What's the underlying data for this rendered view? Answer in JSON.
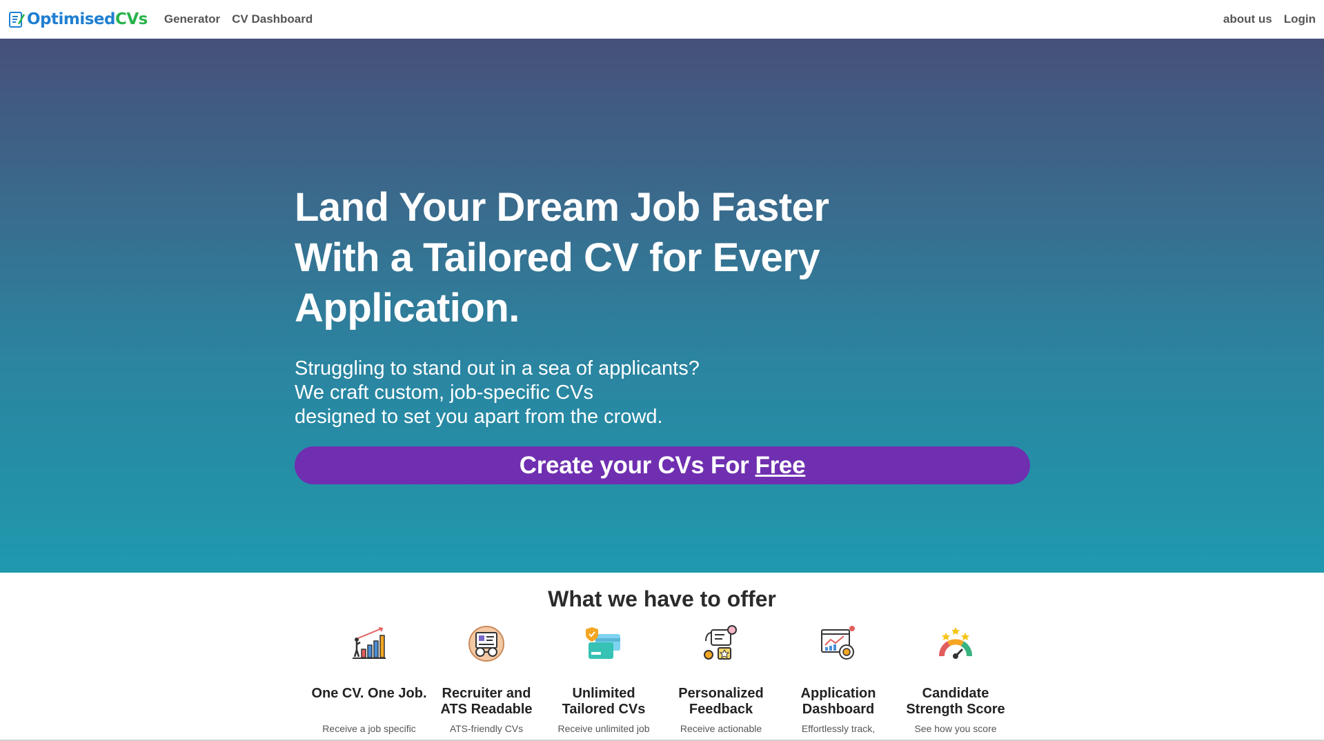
{
  "nav": {
    "brand_part1": "Optimised",
    "brand_part2": "CVs",
    "links": [
      "Generator",
      "CV Dashboard"
    ],
    "right_links": [
      "about us",
      "Login"
    ]
  },
  "hero": {
    "title_line1": "Land Your Dream Job Faster",
    "title_line2": "With a Tailored CV for Every Application.",
    "sub_line1": "Struggling to stand out in a sea of applicants?",
    "sub_line2": "We craft custom, job-specific CVs",
    "sub_line3": "designed to set you apart from the crowd.",
    "cta_text": "Create your CVs For",
    "cta_free": "Free"
  },
  "offer": {
    "title": "What we have to offer",
    "features": [
      {
        "icon": "growth-chart-icon",
        "title": "One CV. One Job.",
        "desc": "Receive a job specific"
      },
      {
        "icon": "robot-reader-icon",
        "title": "Recruiter and ATS Readable",
        "desc": "ATS-friendly CVs"
      },
      {
        "icon": "cards-icon",
        "title": "Unlimited Tailored CVs",
        "desc": "Receive unlimited job"
      },
      {
        "icon": "feedback-icon",
        "title": "Personalized Feedback",
        "desc": "Receive actionable"
      },
      {
        "icon": "dashboard-icon",
        "title": "Application Dashboard",
        "desc": "Effortlessly track,"
      },
      {
        "icon": "gauge-icon",
        "title": "Candidate Strength Score",
        "desc": "See how you score"
      }
    ]
  },
  "colors": {
    "brand_blue": "#1f7fd1",
    "brand_green": "#27b34b",
    "cta_purple": "#6f2fb0",
    "hero_top": "#46507a",
    "hero_bottom": "#1f99ae"
  }
}
